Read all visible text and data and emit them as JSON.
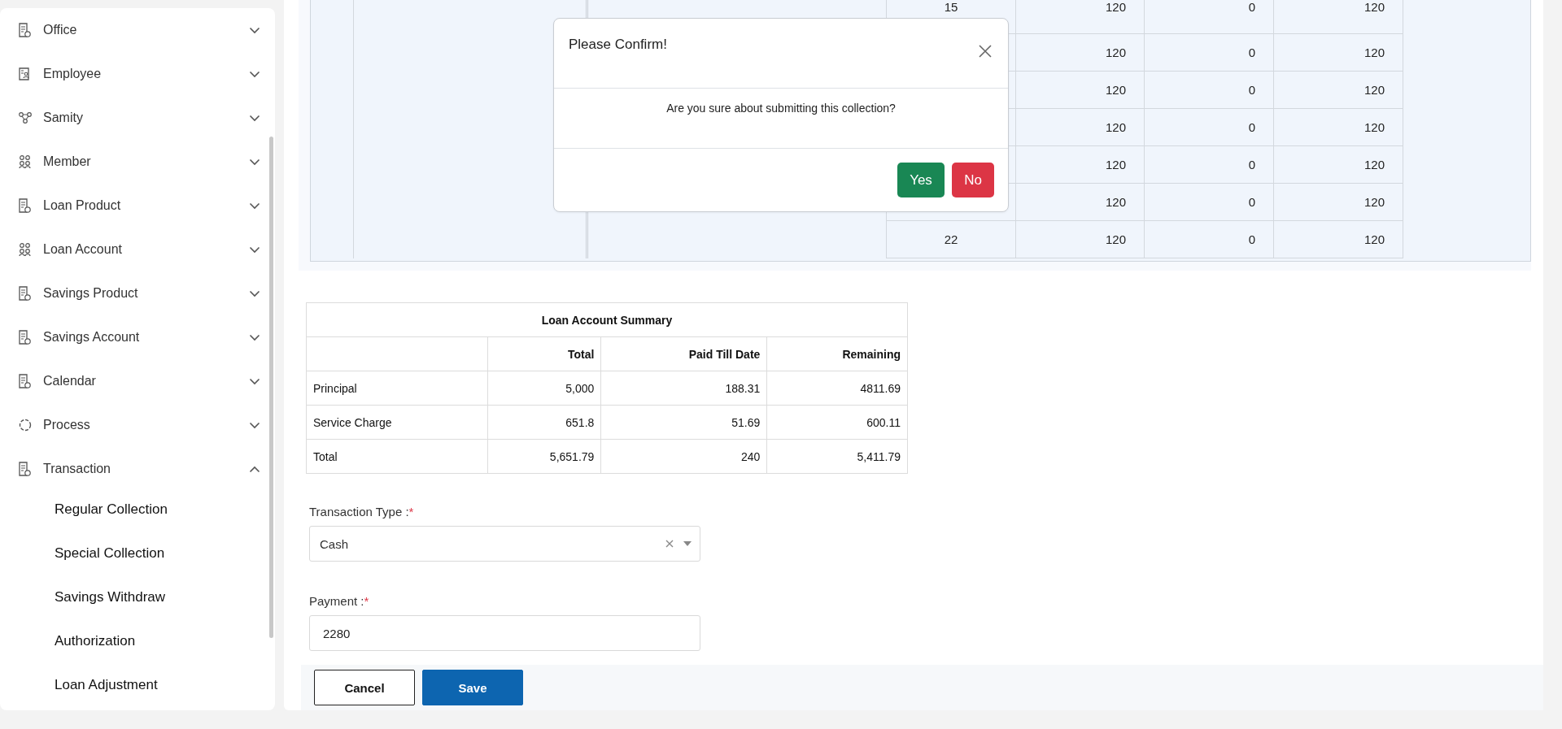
{
  "sidebar": {
    "items": [
      {
        "label": "Office",
        "kind": "document",
        "expanded": false
      },
      {
        "label": "Employee",
        "kind": "badge",
        "expanded": false
      },
      {
        "label": "Samity",
        "kind": "network",
        "expanded": false
      },
      {
        "label": "Member",
        "kind": "people",
        "expanded": false
      },
      {
        "label": "Loan Product",
        "kind": "document",
        "expanded": false
      },
      {
        "label": "Loan Account",
        "kind": "people",
        "expanded": false
      },
      {
        "label": "Savings Product",
        "kind": "document",
        "expanded": false
      },
      {
        "label": "Savings Account",
        "kind": "document",
        "expanded": false
      },
      {
        "label": "Calendar",
        "kind": "document",
        "expanded": false
      },
      {
        "label": "Process",
        "kind": "process",
        "expanded": false
      },
      {
        "label": "Transaction",
        "kind": "document",
        "expanded": true,
        "children": [
          {
            "label": "Regular Collection"
          },
          {
            "label": "Special Collection"
          },
          {
            "label": "Savings Withdraw"
          },
          {
            "label": "Authorization"
          },
          {
            "label": "Loan Adjustment"
          }
        ]
      }
    ]
  },
  "schedule_table": {
    "rows": [
      {
        "column_4": "15",
        "column_5": "120",
        "column_6": "0",
        "column_7": "120"
      },
      {
        "column_5": "120",
        "column_6": "0",
        "column_7": "120"
      },
      {
        "column_5": "120",
        "column_6": "0",
        "column_7": "120"
      },
      {
        "column_5": "120",
        "column_6": "0",
        "column_7": "120"
      },
      {
        "column_5": "120",
        "column_6": "0",
        "column_7": "120"
      },
      {
        "column_5": "120",
        "column_6": "0",
        "column_7": "120"
      },
      {
        "column_4": "22",
        "column_5": "120",
        "column_6": "0",
        "column_7": "120"
      }
    ]
  },
  "summary": {
    "title": "Loan Account Summary",
    "columns": [
      "Total",
      "Paid Till Date",
      "Remaining"
    ],
    "rows": [
      {
        "label": "Principal",
        "values": [
          "5,000",
          "188.31",
          "4811.69"
        ]
      },
      {
        "label": "Service Charge",
        "values": [
          "651.8",
          "51.69",
          "600.11"
        ]
      },
      {
        "label": "Total",
        "values": [
          "5,651.79",
          "240",
          "5,411.79"
        ]
      }
    ]
  },
  "form": {
    "fields": [
      {
        "kind": "select",
        "label": "Transaction Type :",
        "required_mark": "*",
        "value": "Cash"
      },
      {
        "kind": "input",
        "label": "Payment :",
        "required_mark": "*",
        "value": "2280"
      }
    ],
    "buttons": [
      {
        "label": "Cancel",
        "kind": "outline"
      },
      {
        "label": "Save",
        "kind": "primary"
      }
    ]
  },
  "dialog": {
    "title": "Please Confirm!",
    "message": "Are you sure about submitting this collection?",
    "buttons": [
      {
        "label": "Yes",
        "kind": "confirm"
      },
      {
        "label": "No",
        "kind": "cancel"
      }
    ]
  }
}
